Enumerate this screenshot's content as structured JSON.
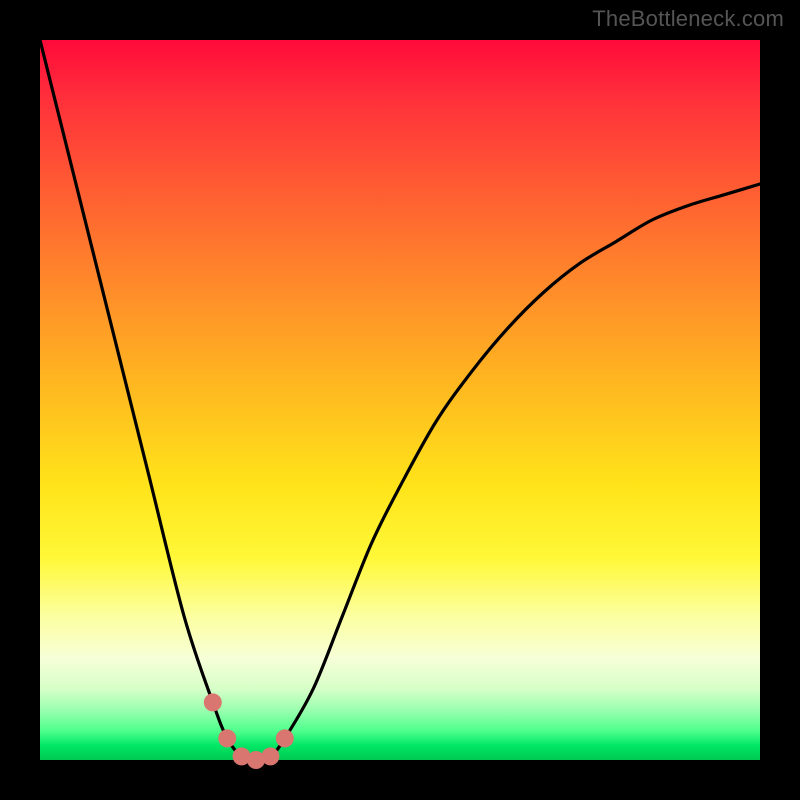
{
  "watermark": {
    "text": "TheBottleneck.com"
  },
  "chart_data": {
    "type": "line",
    "title": "",
    "xlabel": "",
    "ylabel": "",
    "xlim": [
      0,
      100
    ],
    "ylim": [
      0,
      100
    ],
    "grid": false,
    "legend": false,
    "x": [
      0,
      5,
      10,
      15,
      20,
      24,
      26,
      28,
      30,
      32,
      34,
      38,
      42,
      46,
      50,
      55,
      60,
      65,
      70,
      75,
      80,
      85,
      90,
      95,
      100
    ],
    "series": [
      {
        "name": "bottleneck-curve",
        "values": [
          100,
          80,
          60,
          40,
          20,
          8,
          3,
          0.5,
          0,
          0.5,
          3,
          10,
          20,
          30,
          38,
          47,
          54,
          60,
          65,
          69,
          72,
          75,
          77,
          78.5,
          80
        ]
      }
    ],
    "markers": {
      "name": "optimal-range",
      "x": [
        24,
        26,
        28,
        30,
        32,
        34
      ],
      "y": [
        8,
        3,
        0.5,
        0,
        0.5,
        3
      ],
      "color": "#d9766f",
      "size": 9
    },
    "background_gradient": {
      "top": "#ff0a3a",
      "upper_mid": "#ffb820",
      "lower_mid": "#fcffa0",
      "bottom": "#00c850"
    }
  }
}
